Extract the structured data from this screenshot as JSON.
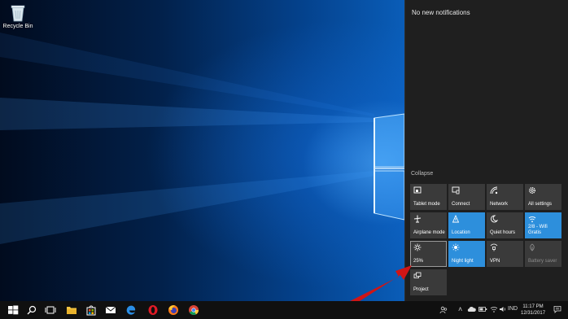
{
  "desktop": {
    "icons": [
      {
        "label": "Recycle Bin",
        "icon": "recycle-bin-icon"
      }
    ]
  },
  "action_center": {
    "notifications_text": "No new notifications",
    "collapse_label": "Collapse",
    "tiles": [
      {
        "label": "Tablet mode",
        "icon": "tablet-mode-icon",
        "state": "off"
      },
      {
        "label": "Connect",
        "icon": "connect-icon",
        "state": "off"
      },
      {
        "label": "Network",
        "icon": "network-icon",
        "state": "off"
      },
      {
        "label": "All settings",
        "icon": "settings-gear-icon",
        "state": "off"
      },
      {
        "label": "Airplane mode",
        "icon": "airplane-icon",
        "state": "off"
      },
      {
        "label": "Location",
        "icon": "location-icon",
        "state": "on"
      },
      {
        "label": "Quiet hours",
        "icon": "moon-icon",
        "state": "off"
      },
      {
        "label": "2/8 - Wifi Gratis",
        "icon": "wifi-icon",
        "state": "on"
      },
      {
        "label": "25%",
        "icon": "brightness-icon",
        "state": "selected"
      },
      {
        "label": "Night light",
        "icon": "night-light-icon",
        "state": "on"
      },
      {
        "label": "VPN",
        "icon": "vpn-icon",
        "state": "off"
      },
      {
        "label": "Battery saver",
        "icon": "battery-saver-icon",
        "state": "disabled"
      },
      {
        "label": "Project",
        "icon": "project-icon",
        "state": "off"
      }
    ]
  },
  "taskbar": {
    "apps": [
      {
        "name": "start-button",
        "icon": "windows-logo-icon"
      },
      {
        "name": "search-button",
        "icon": "search-icon"
      },
      {
        "name": "task-view-button",
        "icon": "task-view-icon"
      },
      {
        "name": "file-explorer-button",
        "icon": "folder-icon"
      },
      {
        "name": "store-button",
        "icon": "store-bag-icon"
      },
      {
        "name": "mail-button",
        "icon": "mail-icon"
      },
      {
        "name": "edge-button",
        "icon": "edge-icon"
      },
      {
        "name": "opera-button",
        "icon": "opera-icon"
      },
      {
        "name": "firefox-button",
        "icon": "firefox-icon"
      },
      {
        "name": "chrome-button",
        "icon": "chrome-icon"
      }
    ],
    "tray": {
      "language": "IND",
      "time": "11:17 PM",
      "date": "12/31/2017"
    }
  },
  "colors": {
    "tile_on": "#2d8fdc",
    "tile_off": "#3a3a3a",
    "panel_bg": "#1f1f1f",
    "taskbar_bg": "#101010",
    "annotation_arrow": "#d01515"
  }
}
